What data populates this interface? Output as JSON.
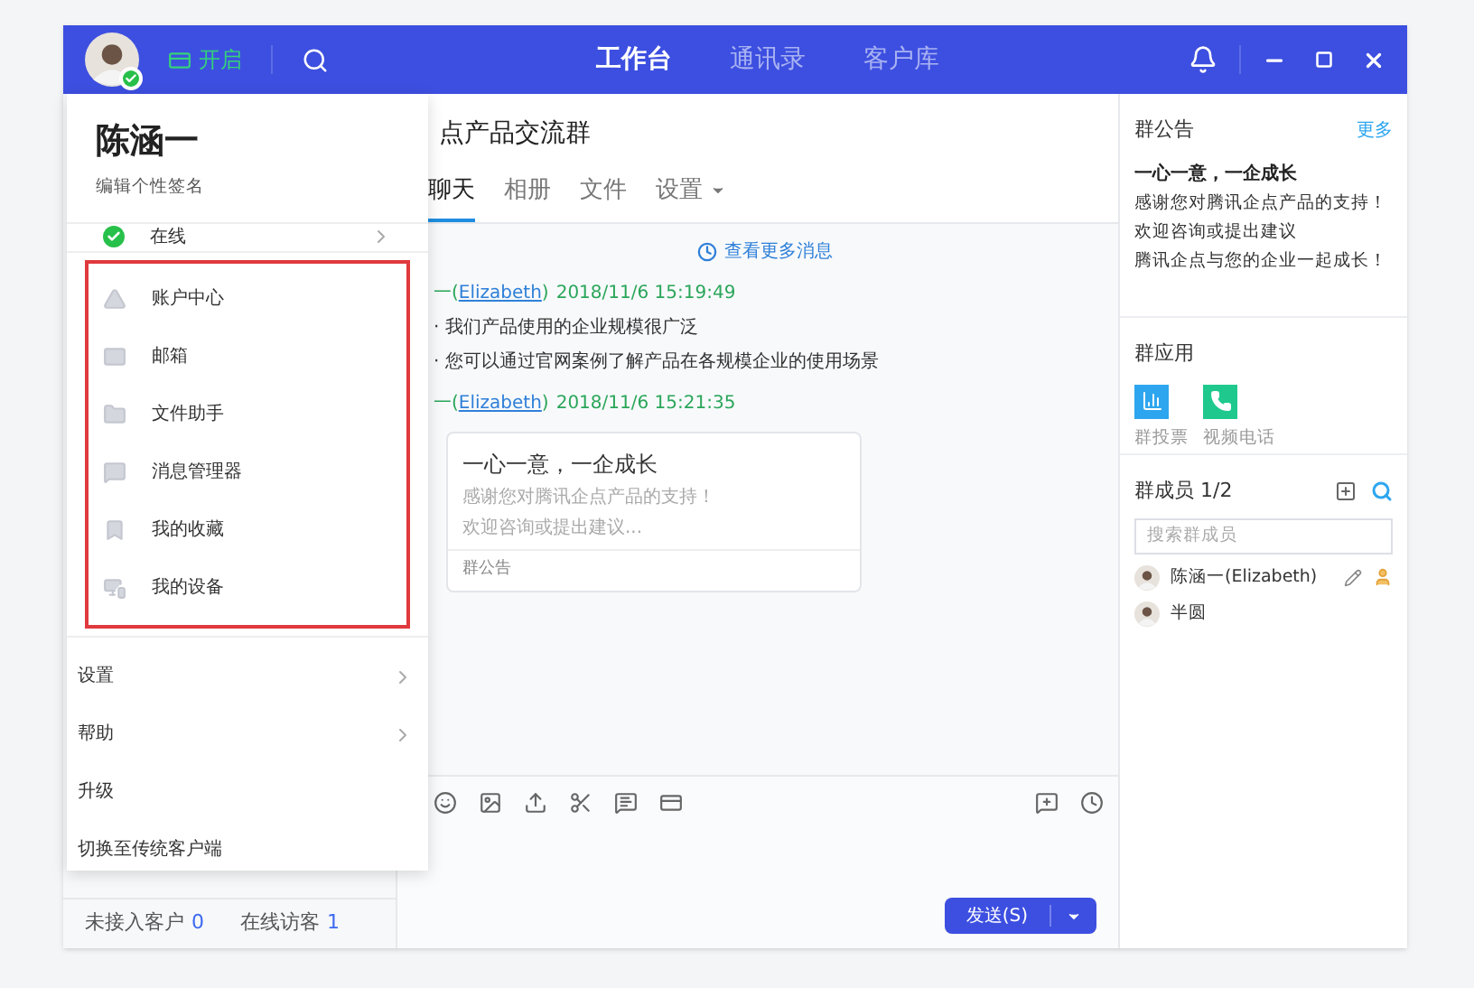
{
  "header": {
    "toggle": {
      "label": "开启",
      "on": true
    },
    "nav": [
      {
        "label": "工作台",
        "selected": true
      },
      {
        "label": "通讯录",
        "selected": false
      },
      {
        "label": "客户库",
        "selected": false
      }
    ]
  },
  "profile_menu": {
    "name": "陈涵一",
    "signature": "编辑个性签名",
    "status": {
      "label": "在线",
      "has_submenu": true
    },
    "groups": [
      {
        "highlighted": true,
        "items": [
          {
            "label": "账户中心",
            "has_submenu": false
          },
          {
            "label": "邮箱",
            "has_submenu": false
          },
          {
            "label": "文件助手",
            "has_submenu": false
          },
          {
            "label": "消息管理器",
            "has_submenu": false
          },
          {
            "label": "我的收藏",
            "has_submenu": false
          },
          {
            "label": "我的设备",
            "has_submenu": false
          }
        ]
      },
      {
        "highlighted": false,
        "items": [
          {
            "label": "设置",
            "has_submenu": true
          },
          {
            "label": "帮助",
            "has_submenu": true
          },
          {
            "label": "升级",
            "has_submenu": false
          },
          {
            "label": "切换至传统客户端",
            "has_submenu": false
          }
        ]
      }
    ]
  },
  "sidebar_footer": [
    {
      "label": "未接入客户",
      "count": "0"
    },
    {
      "label": "在线访客",
      "count": "1"
    }
  ],
  "chat": {
    "title": "点产品交流群",
    "tabs": [
      {
        "label": "聊天",
        "selected": true,
        "dropdown": false
      },
      {
        "label": "相册",
        "selected": false,
        "dropdown": false
      },
      {
        "label": "文件",
        "selected": false,
        "dropdown": false
      },
      {
        "label": "设置",
        "selected": false,
        "dropdown": true
      }
    ],
    "load_more": "查看更多消息",
    "messages": [
      {
        "prefix": "一(",
        "alias": "Elizabeth",
        "suffix": ")",
        "time": "2018/11/6 15:19:49",
        "kind": "text",
        "lines": [
          "· 我们产品使用的企业规模很广泛",
          "· 您可以通过官网案例了解产品在各规模企业的使用场景"
        ]
      },
      {
        "prefix": "一(",
        "alias": "Elizabeth",
        "suffix": ")",
        "time": "2018/11/6 15:21:35",
        "kind": "card",
        "card": {
          "title": "一心一意，一企成长",
          "lines": [
            "感谢您对腾讯企点产品的支持！",
            "欢迎咨询或提出建议..."
          ],
          "footer": "群公告"
        }
      }
    ],
    "send_button": "发送(S)"
  },
  "right_panel": {
    "notice": {
      "title": "群公告",
      "more": "更多",
      "headline": "一心一意，一企成长",
      "lines": [
        "感谢您对腾讯企点产品的支持！",
        "欢迎咨询或提出建议",
        "腾讯企点与您的企业一起成长！"
      ]
    },
    "apps": {
      "title": "群应用",
      "items": [
        {
          "label": "群投票",
          "color": "#2ea6ef"
        },
        {
          "label": "视频电话",
          "color": "#1fc98e"
        }
      ]
    },
    "members": {
      "title": "群成员 1/2",
      "search_placeholder": "搜索群成员",
      "list": [
        {
          "name": "陈涵一(Elizabeth)",
          "admin": true
        },
        {
          "name": "半圆",
          "admin": false
        }
      ]
    }
  }
}
